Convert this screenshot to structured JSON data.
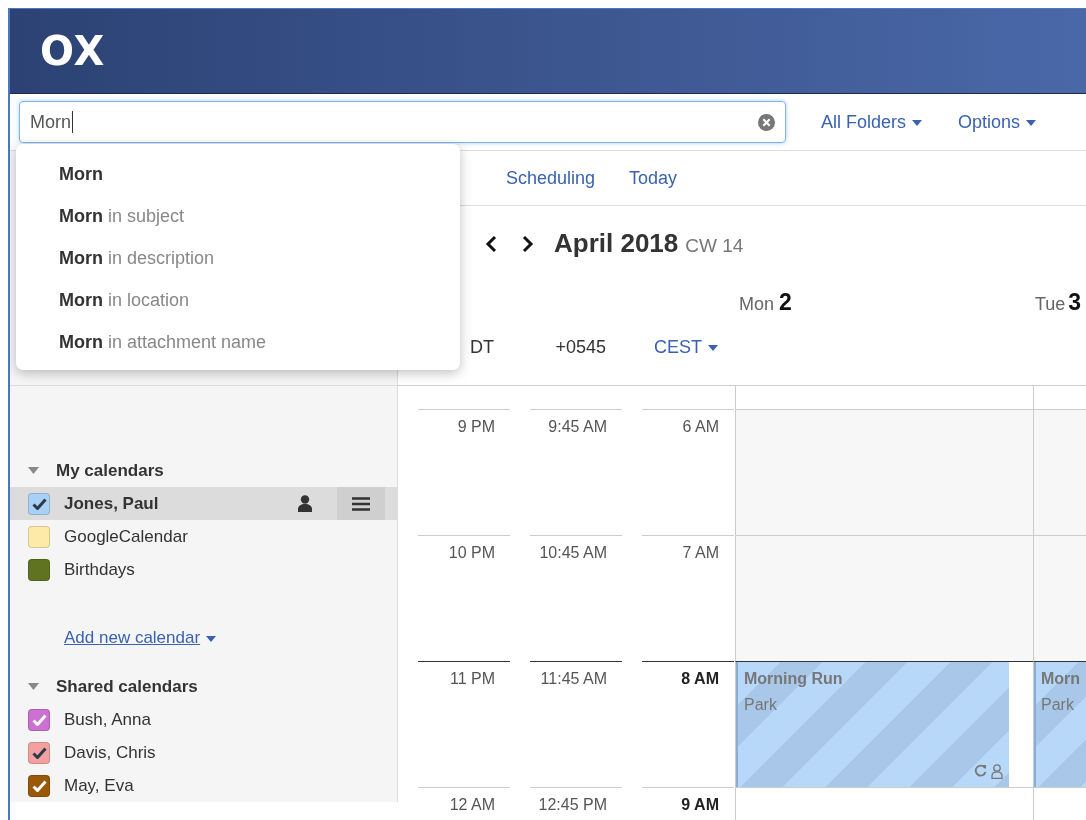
{
  "logo": "OX",
  "search": {
    "value": "Morn",
    "suggestions": [
      {
        "term": "Morn"
      },
      {
        "term": "Morn",
        "qualifier": "in subject"
      },
      {
        "term": "Morn",
        "qualifier": "in description"
      },
      {
        "term": "Morn",
        "qualifier": "in location"
      },
      {
        "term": "Morn",
        "qualifier": "in attachment name"
      }
    ]
  },
  "toolbar": {
    "folders": "All Folders",
    "options": "Options"
  },
  "view_toolbar": [
    "Scheduling",
    "Today"
  ],
  "heading": {
    "month": "April 2018",
    "week": "CW 14"
  },
  "days": [
    {
      "weekday": "Mon",
      "date": "2"
    },
    {
      "weekday": "Tue",
      "date": "3"
    }
  ],
  "timezones": [
    {
      "label": "DT",
      "dropdown": false
    },
    {
      "label": "+0545",
      "dropdown": false
    },
    {
      "label": "CEST",
      "dropdown": true
    }
  ],
  "time_rows": [
    {
      "times": [
        "9 PM",
        "9:45 AM",
        "6 AM"
      ],
      "working": false,
      "events": []
    },
    {
      "times": [
        "10 PM",
        "10:45 AM",
        "7 AM"
      ],
      "working": false,
      "events": []
    },
    {
      "times": [
        "11 PM",
        "11:45 AM",
        "8 AM"
      ],
      "working": true,
      "events": [
        {
          "title": "Morning Run",
          "location": "Park",
          "recurring": true,
          "private": true
        },
        {
          "title": "Morn",
          "location": "Park"
        }
      ]
    },
    {
      "times": [
        "12 AM",
        "12:45 PM",
        "9 AM"
      ],
      "working": true,
      "events": []
    }
  ],
  "sidebar": {
    "sections": [
      {
        "title": "My calendars",
        "expanded": true,
        "add_link": "Add new calendar",
        "items": [
          {
            "name": "Jones, Paul",
            "color": "#a9d0f5",
            "checked": true,
            "selected": true
          },
          {
            "name": "GoogleCalendar",
            "color": "#fde9a8",
            "checked": false,
            "selected": false
          },
          {
            "name": "Birthdays",
            "color": "#5f7320",
            "checked": false,
            "selected": false
          }
        ]
      },
      {
        "title": "Shared calendars",
        "expanded": true,
        "items": [
          {
            "name": "Bush, Anna",
            "color": "#cc70d2",
            "checked": true,
            "selected": false
          },
          {
            "name": "Davis, Chris",
            "color": "#f2a0a0",
            "checked": true,
            "selected": false
          },
          {
            "name": "May, Eva",
            "color": "#9a5808",
            "checked": true,
            "selected": false
          }
        ]
      }
    ]
  }
}
